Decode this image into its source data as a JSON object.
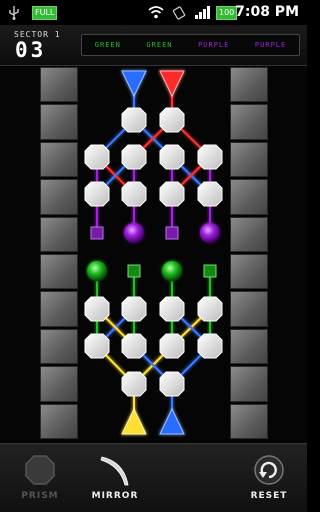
{
  "status_bar": {
    "battery_text": "FULL",
    "battery_level": "100",
    "time": "7:08 PM",
    "icons": [
      "usb-icon",
      "battery-icon",
      "wifi-icon",
      "rotate-icon",
      "signal-icon",
      "battery-icon"
    ]
  },
  "header": {
    "sector_label": "SECTOR 1",
    "sector_number": "03",
    "targets": [
      {
        "label": "GREEN",
        "color": "#20c020"
      },
      {
        "label": "GREEN",
        "color": "#20c020"
      },
      {
        "label": "PURPLE",
        "color": "#a020e0"
      },
      {
        "label": "PURPLE",
        "color": "#a020e0"
      }
    ]
  },
  "board": {
    "emitters": [
      {
        "color": "blue",
        "hex": "#2a6cff"
      },
      {
        "color": "red",
        "hex": "#ff2a2a"
      },
      {
        "color": "yellow",
        "hex": "#ffe033"
      },
      {
        "color": "blue",
        "hex": "#2a6cff"
      }
    ],
    "receivers": [
      "purple-square",
      "purple-orb",
      "purple-square",
      "purple-orb",
      "green-orb",
      "green-square",
      "green-orb",
      "green-square"
    ]
  },
  "toolbar": {
    "prism_label": "PRISM",
    "mirror_label": "MIRROR",
    "reset_label": "RESET",
    "icons": [
      "prism-icon",
      "mirror-icon",
      "reset-icon"
    ]
  },
  "colors": {
    "red": "#ff2a2a",
    "blue": "#2a6cff",
    "yellow": "#ffe033",
    "purple": "#a020e0",
    "green": "#20c020"
  }
}
